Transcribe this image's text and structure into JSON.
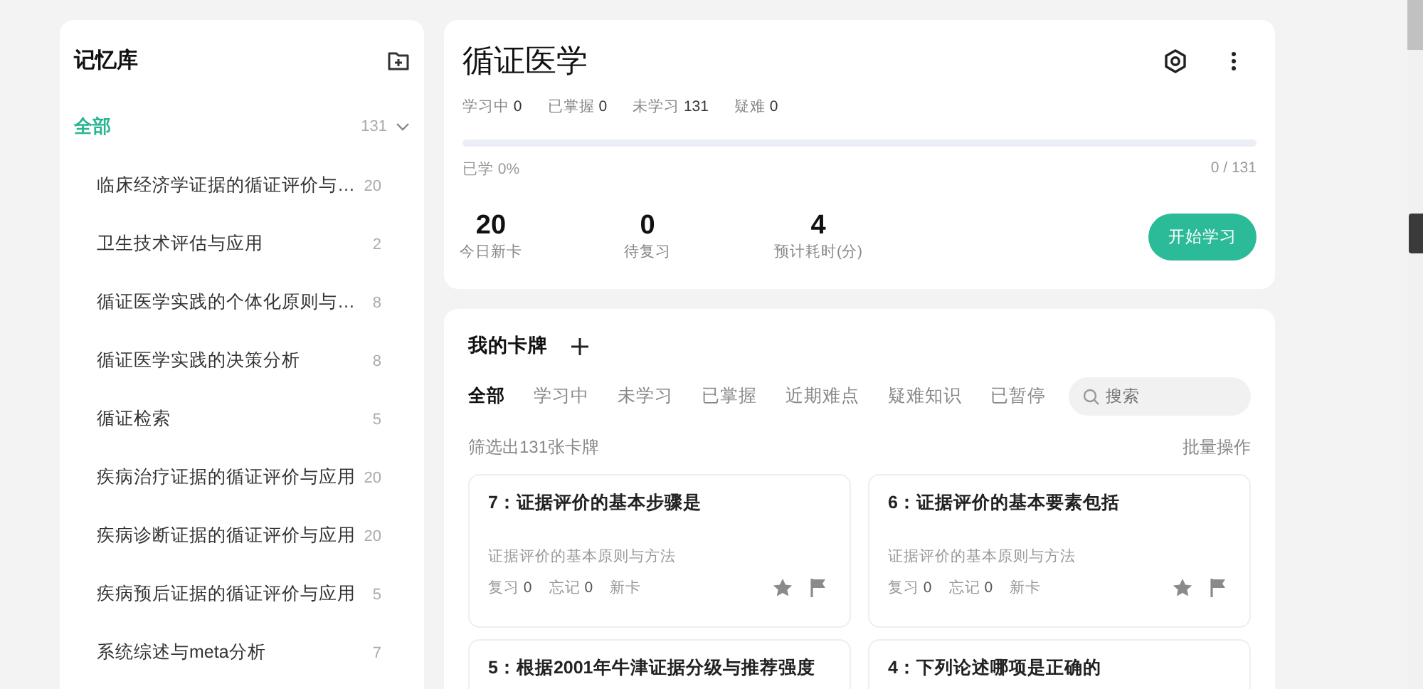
{
  "sidebar": {
    "title": "记忆库",
    "all": {
      "label": "全部",
      "count": "131",
      "selected": true,
      "expanded": true
    },
    "items": [
      {
        "label": "临床经济学证据的循证评价与…",
        "count": "20",
        "selected": false
      },
      {
        "label": "卫生技术评估与应用",
        "count": "2",
        "selected": false
      },
      {
        "label": "循证医学实践的个体化原则与…",
        "count": "8",
        "selected": false
      },
      {
        "label": "循证医学实践的决策分析",
        "count": "8",
        "selected": false
      },
      {
        "label": "循证检索",
        "count": "5",
        "selected": false
      },
      {
        "label": "疾病治疗证据的循证评价与应用",
        "count": "20",
        "selected": false
      },
      {
        "label": "疾病诊断证据的循证评价与应用",
        "count": "20",
        "selected": false
      },
      {
        "label": "疾病预后证据的循证评价与应用",
        "count": "5",
        "selected": false
      },
      {
        "label": "系统综述与meta分析",
        "count": "7",
        "selected": false
      }
    ]
  },
  "deck": {
    "title": "循证医学",
    "stats": [
      {
        "label": "学习中",
        "value": "0"
      },
      {
        "label": "已掌握",
        "value": "0"
      },
      {
        "label": "未学习",
        "value": "131"
      },
      {
        "label": "疑难",
        "value": "0"
      }
    ],
    "progress": {
      "level": 0,
      "label": "已学 0%",
      "reading": "0 / 131"
    },
    "summary": [
      {
        "value": "20",
        "label": "今日新卡"
      },
      {
        "value": "0",
        "label": "待复习"
      },
      {
        "value": "4",
        "label": "预计耗时(分)"
      }
    ],
    "start_button": "开始学习"
  },
  "cards_panel": {
    "title": "我的卡牌",
    "tabs": [
      {
        "label": "全部",
        "selected": true
      },
      {
        "label": "学习中",
        "selected": false
      },
      {
        "label": "未学习",
        "selected": false
      },
      {
        "label": "已掌握",
        "selected": false
      },
      {
        "label": "近期难点",
        "selected": false
      },
      {
        "label": "疑难知识",
        "selected": false
      },
      {
        "label": "已暂停",
        "selected": false
      }
    ],
    "search": {
      "placeholder": "搜索"
    },
    "filter_text": "筛选出131张卡牌",
    "batch_button": "批量操作",
    "cards": [
      {
        "title": "7：证据评价的基本步骤是",
        "topic": "证据评价的基本原则与方法",
        "review_label": "复习",
        "review": "0",
        "forget_label": "忘记",
        "forget": "0",
        "status": "新卡"
      },
      {
        "title": "6：证据评价的基本要素包括",
        "topic": "证据评价的基本原则与方法",
        "review_label": "复习",
        "review": "0",
        "forget_label": "忘记",
        "forget": "0",
        "status": "新卡"
      },
      {
        "title": "5：根据2001年牛津证据分级与推荐强度"
      },
      {
        "title": "4：下列论述哪项是正确的"
      }
    ]
  }
}
